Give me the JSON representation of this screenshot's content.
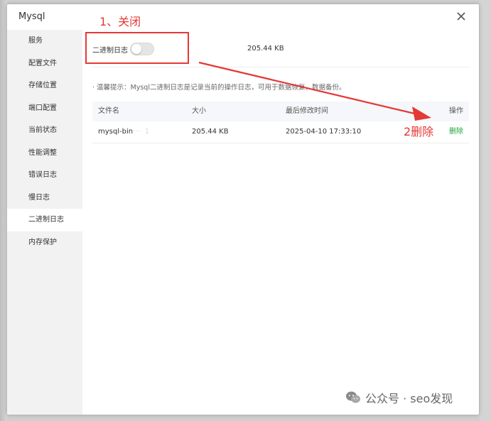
{
  "dialog": {
    "title": "Mysql"
  },
  "sidebar": {
    "items": [
      {
        "label": "服务"
      },
      {
        "label": "配置文件"
      },
      {
        "label": "存储位置"
      },
      {
        "label": "端口配置"
      },
      {
        "label": "当前状态"
      },
      {
        "label": "性能调整"
      },
      {
        "label": "错误日志"
      },
      {
        "label": "慢日志"
      },
      {
        "label": "二进制日志"
      },
      {
        "label": "内存保护"
      }
    ],
    "active_index": 8
  },
  "binlog": {
    "toggle_label": "二进制日志",
    "enabled": false,
    "total_size": "205.44 KB",
    "tip": "· 温馨提示：Mysql二进制日志是记录当前的操作日志，可用于数据恢复，数据备份。"
  },
  "table": {
    "headers": [
      "文件名",
      "大小",
      "最后修改时间",
      "操作"
    ],
    "rows": [
      {
        "name": "mysql-bin",
        "name_suffix": "··· 1",
        "size": "205.44 KB",
        "modified": "2025-04-10 17:33:10",
        "action": "删除"
      }
    ]
  },
  "annotations": {
    "step1": "1、关闭",
    "step2": "2删除",
    "color": "#e53935"
  },
  "watermark": {
    "text": "公众号 · seo发现"
  },
  "colors": {
    "accent_green": "#20a53a",
    "annotation_red": "#e53935"
  }
}
